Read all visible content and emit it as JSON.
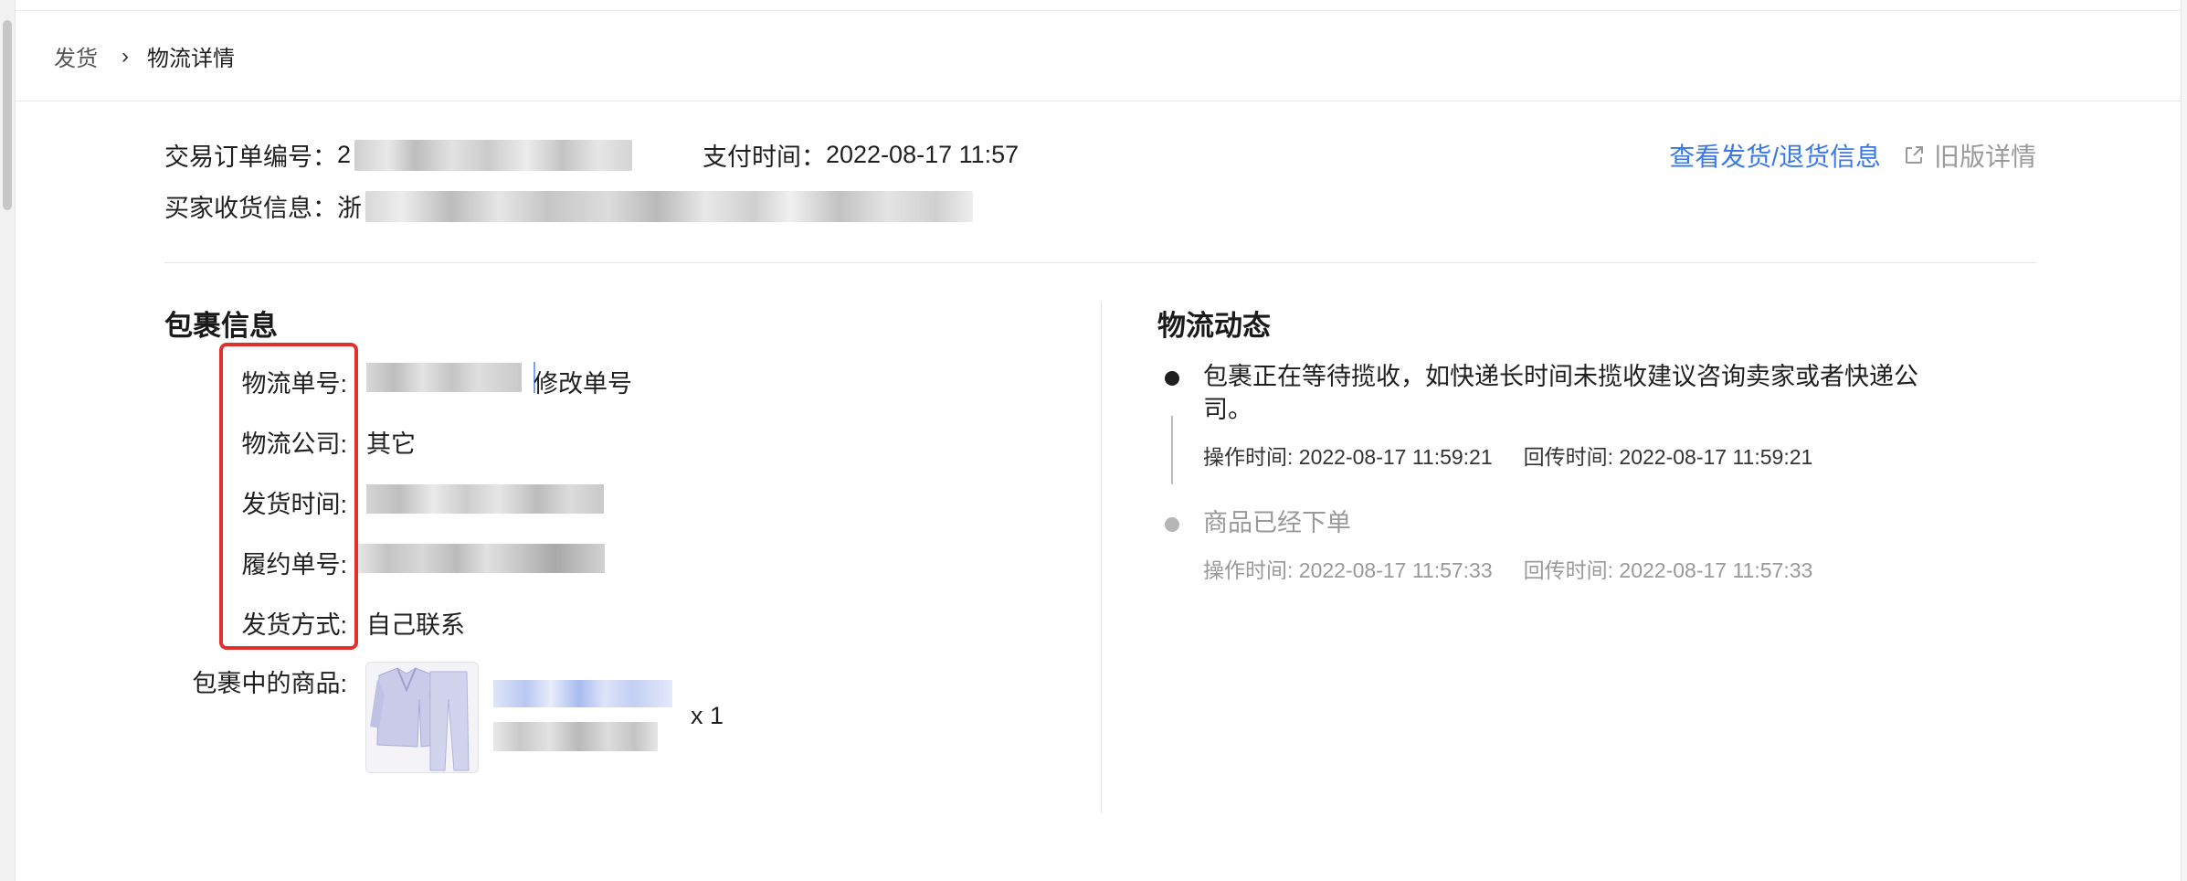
{
  "breadcrumb": {
    "parent": "发货",
    "separator": "›",
    "current": "物流详情"
  },
  "order": {
    "order_no_label": "交易订单编号：",
    "order_no_visible_prefix": "2",
    "pay_time_label": "支付时间：",
    "pay_time_value": "2022-08-17 11:57",
    "buyer_label": "买家收货信息：",
    "buyer_visible_prefix": "浙"
  },
  "actions": {
    "view_shipping_return": "查看发货/退货信息",
    "old_version": "旧版详情",
    "old_version_icon": "external-link-icon"
  },
  "package": {
    "title": "包裹信息",
    "tracking_no_label": "物流单号:",
    "edit_tracking": "修改单号",
    "company_label": "物流公司:",
    "company_value": "其它",
    "ship_time_label": "发货时间:",
    "fulfil_no_label": "履约单号:",
    "ship_method_label": "发货方式:",
    "ship_method_value": "自己联系",
    "items_label": "包裹中的商品:",
    "item_qty": "x 1"
  },
  "logistics": {
    "title": "物流动态",
    "events": [
      {
        "text": "包裹正在等待揽收，如快递长时间未揽收建议咨询卖家或者快递公司。",
        "op_time": "操作时间: 2022-08-17 11:59:21",
        "callback_time": "回传时间: 2022-08-17 11:59:21"
      },
      {
        "text": "商品已经下单",
        "op_time": "操作时间: 2022-08-17 11:57:33",
        "callback_time": "回传时间: 2022-08-17 11:57:33"
      }
    ]
  },
  "colors": {
    "link_blue": "#3a78e6",
    "highlight_red": "#e0312f",
    "muted_gray": "#999999"
  }
}
